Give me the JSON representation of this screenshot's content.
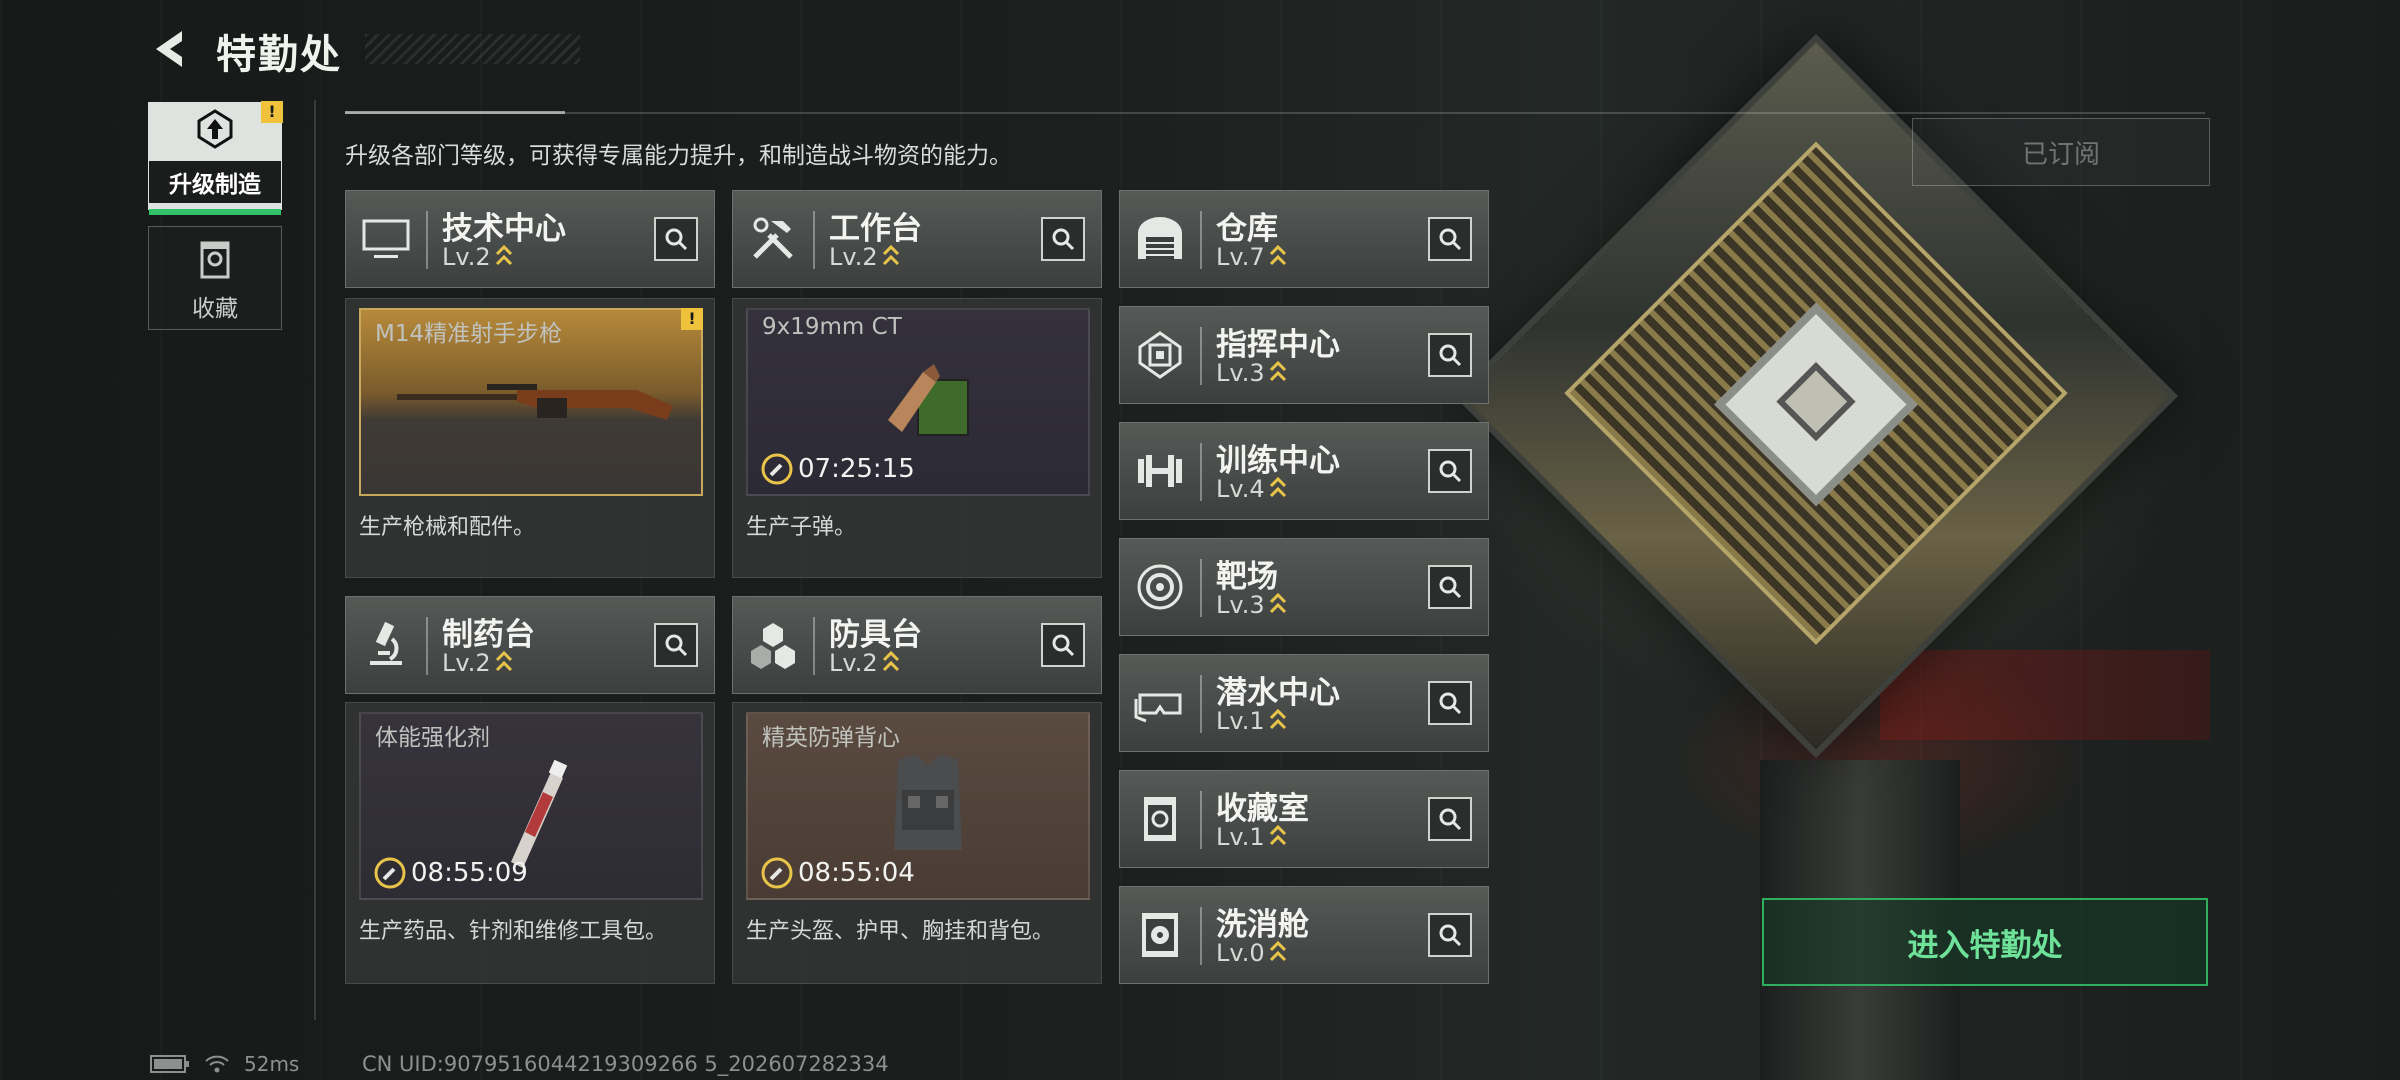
{
  "header": {
    "title": "特勤处",
    "subtitle": "升级各部门等级，可获得专属能力提升，和制造战斗物资的能力。",
    "subscribe_label": "已订阅"
  },
  "sidebar": {
    "items": [
      {
        "label": "升级制造",
        "active": true,
        "alert": "!"
      },
      {
        "label": "收藏",
        "active": false
      }
    ]
  },
  "departments_main": [
    {
      "name": "技术中心",
      "level": "Lv.2",
      "icon": "monitor-icon",
      "product": "M14精准射手步枪",
      "product_alert": "!",
      "timer": "",
      "desc": "生产枪械和配件。"
    },
    {
      "name": "工作台",
      "level": "Lv.2",
      "icon": "tools-icon",
      "product": "9x19mm CT",
      "timer": "07:25:15",
      "desc": "生产子弹。"
    },
    {
      "name": "制药台",
      "level": "Lv.2",
      "icon": "microscope-icon",
      "product": "体能强化剂",
      "timer": "08:55:09",
      "desc": "生产药品、针剂和维修工具包。"
    },
    {
      "name": "防具台",
      "level": "Lv.2",
      "icon": "hexagon-icon",
      "product": "精英防弹背心",
      "timer": "08:55:04",
      "desc": "生产头盔、护甲、胸挂和背包。"
    }
  ],
  "departments_list": [
    {
      "name": "仓库",
      "level": "Lv.7",
      "icon": "garage-icon"
    },
    {
      "name": "指挥中心",
      "level": "Lv.3",
      "icon": "chip-icon"
    },
    {
      "name": "训练中心",
      "level": "Lv.4",
      "icon": "dumbbell-icon"
    },
    {
      "name": "靶场",
      "level": "Lv.3",
      "icon": "target-icon"
    },
    {
      "name": "潜水中心",
      "level": "Lv.1",
      "icon": "goggles-icon"
    },
    {
      "name": "收藏室",
      "level": "Lv.1",
      "icon": "display-case-icon"
    },
    {
      "name": "洗消舱",
      "level": "Lv.0",
      "icon": "decontamination-icon"
    }
  ],
  "enter_button": "进入特勤处",
  "status": {
    "ping": "52ms",
    "uid": "CN UID:9079516044219309266 5_202607282334"
  },
  "colors": {
    "accent_green": "#32c26a",
    "alert_yellow": "#f0c23c",
    "level_gold": "#e8c44a"
  }
}
